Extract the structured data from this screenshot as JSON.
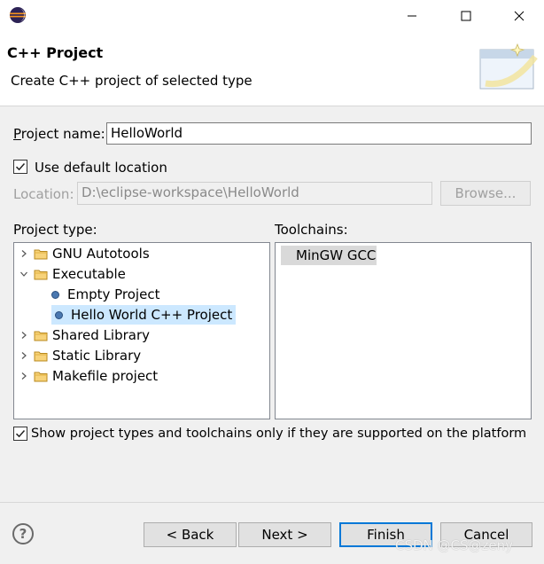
{
  "window": {
    "title": ""
  },
  "banner": {
    "title": "C++ Project",
    "description": "Create C++ project of selected type"
  },
  "form": {
    "project_name_label": "Project name:",
    "project_name_value": "HelloWorld",
    "use_default_label": "Use default location",
    "use_default_checked": true,
    "location_label": "Location:",
    "location_value": "D:\\eclipse-workspace\\HelloWorld",
    "browse_label": "Browse...",
    "project_type_label": "Project type:",
    "toolchains_label": "Toolchains:",
    "show_supported_label": "Show project types and toolchains only if they are supported on the platform",
    "show_supported_checked": true
  },
  "project_types": [
    {
      "label": "GNU Autotools",
      "kind": "folder",
      "expanded": false
    },
    {
      "label": "Executable",
      "kind": "folder",
      "expanded": true
    },
    {
      "label": "Empty Project",
      "kind": "leaf"
    },
    {
      "label": "Hello World C++ Project",
      "kind": "leaf",
      "selected": true
    },
    {
      "label": "Shared Library",
      "kind": "folder",
      "expanded": false
    },
    {
      "label": "Static Library",
      "kind": "folder",
      "expanded": false
    },
    {
      "label": "Makefile project",
      "kind": "folder",
      "expanded": false
    }
  ],
  "toolchains": [
    {
      "label": "MinGW GCC",
      "selected": true
    }
  ],
  "buttons": {
    "back": "< Back",
    "next": "Next >",
    "finish": "Finish",
    "cancel": "Cancel",
    "help": "?"
  },
  "watermark": "CSDN @CS@zeny",
  "colors": {
    "selection": "#cce8ff",
    "toolchain_selection": "#d9d9d9",
    "default_button_border": "#0078d7"
  }
}
